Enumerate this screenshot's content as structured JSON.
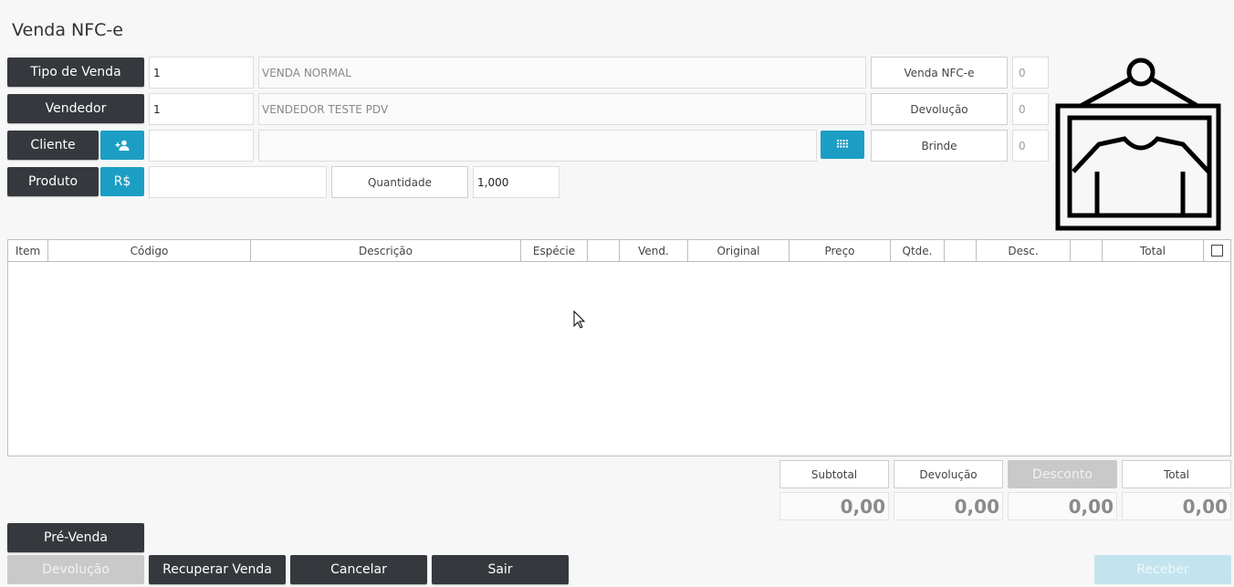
{
  "title": "Venda NFC-e",
  "form": {
    "tipo_venda": {
      "label": "Tipo de Venda",
      "code": "1",
      "desc": "VENDA NORMAL"
    },
    "vendedor": {
      "label": "Vendedor",
      "code": "1",
      "desc": "VENDEDOR TESTE PDV"
    },
    "cliente": {
      "label": "Cliente",
      "code": "",
      "desc": ""
    },
    "produto": {
      "label": "Produto",
      "code": "",
      "price_btn": "R$"
    },
    "quantidade": {
      "label": "Quantidade",
      "value": "1,000"
    }
  },
  "counters": [
    {
      "label": "Venda NFC-e",
      "value": "0"
    },
    {
      "label": "Devolução",
      "value": "0"
    },
    {
      "label": "Brinde",
      "value": "0"
    }
  ],
  "table": {
    "columns": [
      "Item",
      "Código",
      "Descrição",
      "Espécie",
      "",
      "Vend.",
      "Original",
      "Preço",
      "Qtde.",
      "",
      "Desc.",
      "",
      "Total"
    ],
    "rows": []
  },
  "totals": {
    "subtotal": {
      "label": "Subtotal",
      "value": "0,00"
    },
    "devolucao": {
      "label": "Devolução",
      "value": "0,00"
    },
    "desconto": {
      "label": "Desconto",
      "value": "0,00"
    },
    "total": {
      "label": "Total",
      "value": "0,00"
    }
  },
  "actions": {
    "pre_venda": "Pré-Venda",
    "devolucao": "Devolução",
    "recuperar": "Recuperar Venda",
    "cancelar": "Cancelar",
    "sair": "Sair",
    "receber": "Receber"
  },
  "icons": {
    "add_client": "person-add-icon",
    "keypad": "keypad-icon",
    "logo": "shirt-hanger-logo"
  },
  "colors": {
    "dark": "#35383c",
    "accent": "#1c9ec4"
  }
}
